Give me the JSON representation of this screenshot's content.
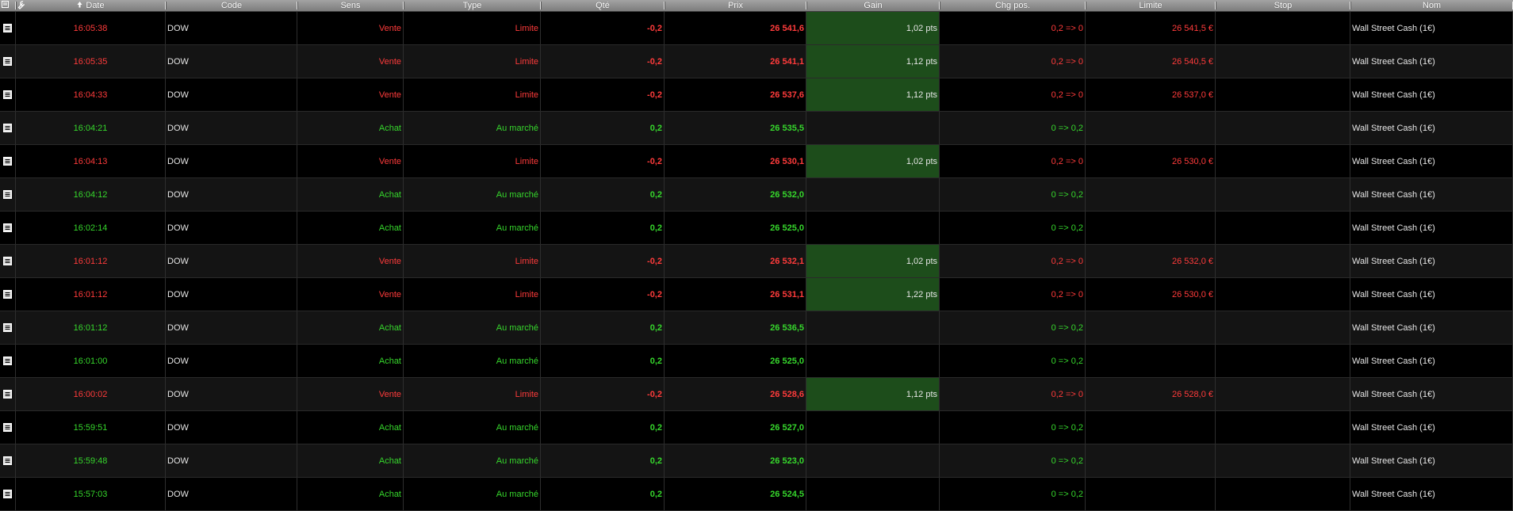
{
  "columns": {
    "date": "Date",
    "code": "Code",
    "sens": "Sens",
    "type": "Type",
    "qte": "Qté",
    "prix": "Prix",
    "gain": "Gain",
    "chg": "Chg pos.",
    "limite": "Limite",
    "stop": "Stop",
    "nom": "Nom"
  },
  "colors": {
    "sell": "#ff3b3b",
    "buy": "#36d72c",
    "gain_bg": "#1d4d1b"
  },
  "icons": {
    "corner_menu": "list-icon",
    "corner_tool": "wrench-icon",
    "sort": "sort-arrow-icon",
    "row": "document-icon"
  },
  "rows": [
    {
      "side": "sell",
      "date": "16:05:38",
      "code": "DOW",
      "sens": "Vente",
      "type": "Limite",
      "qte": "-0,2",
      "prix": "26 541,6",
      "gain": "1,02 pts",
      "chg": "0,2 => 0",
      "limite": "26 541,5 €",
      "stop": "",
      "nom": "Wall Street Cash (1€)"
    },
    {
      "side": "sell",
      "date": "16:05:35",
      "code": "DOW",
      "sens": "Vente",
      "type": "Limite",
      "qte": "-0,2",
      "prix": "26 541,1",
      "gain": "1,12 pts",
      "chg": "0,2 => 0",
      "limite": "26 540,5 €",
      "stop": "",
      "nom": "Wall Street Cash (1€)"
    },
    {
      "side": "sell",
      "date": "16:04:33",
      "code": "DOW",
      "sens": "Vente",
      "type": "Limite",
      "qte": "-0,2",
      "prix": "26 537,6",
      "gain": "1,12 pts",
      "chg": "0,2 => 0",
      "limite": "26 537,0 €",
      "stop": "",
      "nom": "Wall Street Cash (1€)"
    },
    {
      "side": "buy",
      "date": "16:04:21",
      "code": "DOW",
      "sens": "Achat",
      "type": "Au marché",
      "qte": "0,2",
      "prix": "26 535,5",
      "gain": "",
      "chg": "0 => 0,2",
      "limite": "",
      "stop": "",
      "nom": "Wall Street Cash (1€)"
    },
    {
      "side": "sell",
      "date": "16:04:13",
      "code": "DOW",
      "sens": "Vente",
      "type": "Limite",
      "qte": "-0,2",
      "prix": "26 530,1",
      "gain": "1,02 pts",
      "chg": "0,2 => 0",
      "limite": "26 530,0 €",
      "stop": "",
      "nom": "Wall Street Cash (1€)"
    },
    {
      "side": "buy",
      "date": "16:04:12",
      "code": "DOW",
      "sens": "Achat",
      "type": "Au marché",
      "qte": "0,2",
      "prix": "26 532,0",
      "gain": "",
      "chg": "0 => 0,2",
      "limite": "",
      "stop": "",
      "nom": "Wall Street Cash (1€)"
    },
    {
      "side": "buy",
      "date": "16:02:14",
      "code": "DOW",
      "sens": "Achat",
      "type": "Au marché",
      "qte": "0,2",
      "prix": "26 525,0",
      "gain": "",
      "chg": "0 => 0,2",
      "limite": "",
      "stop": "",
      "nom": "Wall Street Cash (1€)"
    },
    {
      "side": "sell",
      "date": "16:01:12",
      "code": "DOW",
      "sens": "Vente",
      "type": "Limite",
      "qte": "-0,2",
      "prix": "26 532,1",
      "gain": "1,02 pts",
      "chg": "0,2 => 0",
      "limite": "26 532,0 €",
      "stop": "",
      "nom": "Wall Street Cash (1€)"
    },
    {
      "side": "sell",
      "date": "16:01:12",
      "code": "DOW",
      "sens": "Vente",
      "type": "Limite",
      "qte": "-0,2",
      "prix": "26 531,1",
      "gain": "1,22 pts",
      "chg": "0,2 => 0",
      "limite": "26 530,0 €",
      "stop": "",
      "nom": "Wall Street Cash (1€)"
    },
    {
      "side": "buy",
      "date": "16:01:12",
      "code": "DOW",
      "sens": "Achat",
      "type": "Au marché",
      "qte": "0,2",
      "prix": "26 536,5",
      "gain": "",
      "chg": "0 => 0,2",
      "limite": "",
      "stop": "",
      "nom": "Wall Street Cash (1€)"
    },
    {
      "side": "buy",
      "date": "16:01:00",
      "code": "DOW",
      "sens": "Achat",
      "type": "Au marché",
      "qte": "0,2",
      "prix": "26 525,0",
      "gain": "",
      "chg": "0 => 0,2",
      "limite": "",
      "stop": "",
      "nom": "Wall Street Cash (1€)"
    },
    {
      "side": "sell",
      "date": "16:00:02",
      "code": "DOW",
      "sens": "Vente",
      "type": "Limite",
      "qte": "-0,2",
      "prix": "26 528,6",
      "gain": "1,12 pts",
      "chg": "0,2 => 0",
      "limite": "26 528,0 €",
      "stop": "",
      "nom": "Wall Street Cash (1€)"
    },
    {
      "side": "buy",
      "date": "15:59:51",
      "code": "DOW",
      "sens": "Achat",
      "type": "Au marché",
      "qte": "0,2",
      "prix": "26 527,0",
      "gain": "",
      "chg": "0 => 0,2",
      "limite": "",
      "stop": "",
      "nom": "Wall Street Cash (1€)"
    },
    {
      "side": "buy",
      "date": "15:59:48",
      "code": "DOW",
      "sens": "Achat",
      "type": "Au marché",
      "qte": "0,2",
      "prix": "26 523,0",
      "gain": "",
      "chg": "0 => 0,2",
      "limite": "",
      "stop": "",
      "nom": "Wall Street Cash (1€)"
    },
    {
      "side": "buy",
      "date": "15:57:03",
      "code": "DOW",
      "sens": "Achat",
      "type": "Au marché",
      "qte": "0,2",
      "prix": "26 524,5",
      "gain": "",
      "chg": "0 => 0,2",
      "limite": "",
      "stop": "",
      "nom": "Wall Street Cash (1€)"
    }
  ]
}
